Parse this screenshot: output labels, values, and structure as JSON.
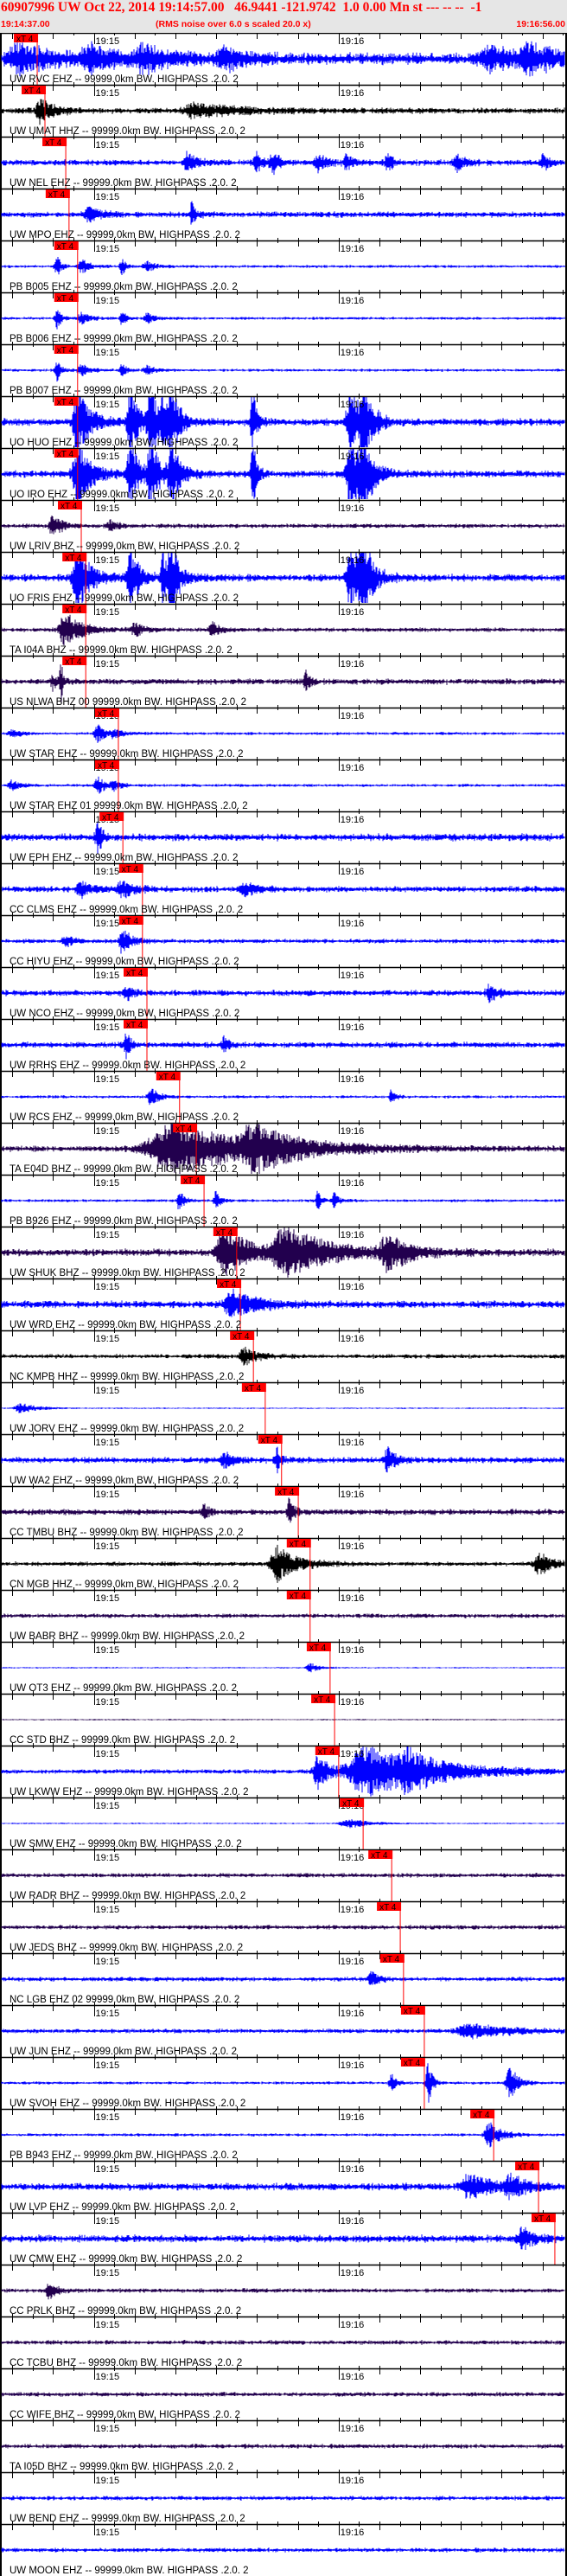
{
  "header": {
    "title_line": "60907996 UW Oct 22, 2014 19:14:57.00   46.9441 -121.9742  1.0 0.00 Mn st --- -- --  -1",
    "start_time": "19:14:37.00",
    "note": "(RMS noise over 6.0 s scaled 20.0 x)",
    "end_time": "19:16:56.00"
  },
  "colors": {
    "blue": "#0000ff",
    "purple": "#22004e",
    "black": "#000000",
    "marker": "#ff0000",
    "header_bg": "#e6e6e6"
  },
  "chart_data": {
    "type": "line",
    "title": "60907996 UW Oct 22, 2014 19:14:57.00 seismograms",
    "x_unit": "seconds after 19:14:37",
    "xlim": [
      0,
      139
    ],
    "time_ticks": [
      {
        "t": 23,
        "label": "19:15"
      },
      {
        "t": 83,
        "label": "19:16"
      }
    ],
    "marker_label": "xT 4",
    "traces": [
      {
        "label": "UW RVC EHZ -- 99999.0km BW. HIGHPASS .2.0. 2",
        "color": "blue",
        "noise": 8,
        "marker": 3.4,
        "events": [
          [
            4,
            16,
            8
          ],
          [
            22,
            14,
            6
          ],
          [
            35,
            14,
            6
          ],
          [
            55,
            12,
            5
          ],
          [
            120,
            12,
            8
          ],
          [
            130,
            14,
            6
          ]
        ]
      },
      {
        "label": "UW UMAT HHZ -- 99999.0km BW. HIGHPASS .2.0. 2",
        "color": "black",
        "noise": 4,
        "marker": 5.3,
        "events": [
          [
            10,
            14,
            3
          ],
          [
            48,
            8,
            10
          ]
        ]
      },
      {
        "label": "UW NEL EHZ -- 99999.0km BW. HIGHPASS .2.0. 2",
        "color": "blue",
        "noise": 4,
        "marker": 10.4,
        "events": [
          [
            46,
            12,
            2
          ],
          [
            63,
            10,
            2
          ],
          [
            67,
            14,
            1.5
          ],
          [
            78,
            10,
            2
          ],
          [
            85,
            10,
            1.5
          ],
          [
            95,
            14,
            1
          ],
          [
            112,
            10,
            2
          ],
          [
            133,
            10,
            1.5
          ]
        ]
      },
      {
        "label": "UW MPO EHZ -- 99999.0km BW. HIGHPASS .2.0. 2",
        "color": "blue",
        "noise": 4,
        "marker": 11.2,
        "events": [
          [
            47,
            14,
            1
          ],
          [
            22,
            8,
            3
          ]
        ]
      },
      {
        "label": "PB B005 EHZ -- 99999.0km BW. HIGHPASS .2.0. 2",
        "color": "blue",
        "noise": 2,
        "marker": 13.3,
        "events": [
          [
            14,
            12,
            1
          ],
          [
            20,
            8,
            2
          ],
          [
            30,
            10,
            1
          ],
          [
            36,
            6,
            2
          ]
        ]
      },
      {
        "label": "PB B006 EHZ -- 99999.0km BW. HIGHPASS .2.0. 2",
        "color": "blue",
        "noise": 2,
        "marker": 13.3,
        "events": [
          [
            14,
            12,
            1
          ],
          [
            20,
            8,
            2
          ],
          [
            30,
            8,
            1
          ],
          [
            36,
            6,
            2
          ]
        ]
      },
      {
        "label": "PB B007 EHZ -- 99999.0km BW. HIGHPASS .2.0. 2",
        "color": "blue",
        "noise": 2,
        "marker": 13.3,
        "events": [
          [
            14,
            12,
            1
          ],
          [
            20,
            7,
            2
          ],
          [
            30,
            8,
            1
          ],
          [
            36,
            6,
            2
          ]
        ]
      },
      {
        "label": "UO HUO EHZ -- 99999.0km BW. HIGHPASS .2.0. 2",
        "color": "blue",
        "noise": 5,
        "marker": 13.3,
        "events": [
          [
            19,
            40,
            3
          ],
          [
            32,
            40,
            2
          ],
          [
            37,
            40,
            2
          ],
          [
            40,
            25,
            1
          ],
          [
            42,
            40,
            2
          ],
          [
            62,
            40,
            1
          ],
          [
            86,
            40,
            3
          ],
          [
            89,
            40,
            2
          ]
        ]
      },
      {
        "label": "UO IRO EHZ -- 99999.0km BW. HIGHPASS .2.0. 2",
        "color": "blue",
        "noise": 5,
        "marker": 13.3,
        "events": [
          [
            19,
            40,
            3
          ],
          [
            32,
            40,
            2
          ],
          [
            37,
            40,
            2
          ],
          [
            42,
            40,
            2
          ],
          [
            62,
            40,
            1
          ],
          [
            86,
            40,
            3
          ],
          [
            89,
            40,
            2
          ]
        ]
      },
      {
        "label": "UW LRIV BHZ -- 99999.0km BW. HIGHPASS .2.0. 2",
        "color": "purple",
        "noise": 3,
        "marker": 14.2,
        "events": [
          [
            13,
            14,
            2
          ],
          [
            27,
            6,
            2
          ]
        ]
      },
      {
        "label": "UO FRIS EHZ -- 99999.0km BW. HIGHPASS .2.0. 2",
        "color": "blue",
        "noise": 5,
        "marker": 15.3,
        "events": [
          [
            19,
            40,
            3
          ],
          [
            32,
            40,
            2
          ],
          [
            40,
            30,
            1
          ],
          [
            42,
            40,
            2
          ],
          [
            86,
            40,
            3
          ],
          [
            89,
            40,
            2
          ]
        ]
      },
      {
        "label": "TA I04A BHZ -- 99999.0km BW. HIGHPASS .2.0. 2",
        "color": "purple",
        "noise": 3,
        "marker": 15.3,
        "events": [
          [
            16,
            20,
            4
          ],
          [
            33,
            8,
            2
          ],
          [
            52,
            8,
            2
          ]
        ]
      },
      {
        "label": "US NLWA BHZ 00 99999.0km BW. HIGHPASS .2.0. 2",
        "color": "purple",
        "noise": 4,
        "marker": 15.3,
        "events": [
          [
            13,
            8,
            1
          ],
          [
            15,
            25,
            0.5
          ],
          [
            75,
            12,
            1
          ]
        ]
      },
      {
        "label": "UW STAR EHZ -- 99999.0km BW. HIGHPASS .2.0. 2",
        "color": "blue",
        "noise": 2,
        "marker": 23.3,
        "events": [
          [
            3,
            6,
            2
          ],
          [
            24,
            10,
            2
          ],
          [
            28,
            5,
            2
          ]
        ]
      },
      {
        "label": "UW STAR EHZ 01 99999.0km BW. HIGHPASS .2.0. 2",
        "color": "blue",
        "noise": 2,
        "marker": 23.3,
        "events": [
          [
            3,
            6,
            2
          ],
          [
            24,
            10,
            2
          ],
          [
            28,
            5,
            2
          ]
        ]
      },
      {
        "label": "UW EPH EHZ -- 99999.0km BW. HIGHPASS .2.0. 2",
        "color": "blue",
        "noise": 5,
        "marker": 24.4,
        "events": [
          [
            24,
            20,
            1
          ]
        ]
      },
      {
        "label": "CC CLMS EHZ -- 99999.0km BW. HIGHPASS .2.0. 2",
        "color": "blue",
        "noise": 4,
        "marker": 29.2,
        "events": [
          [
            20,
            8,
            3
          ],
          [
            30,
            10,
            3
          ],
          [
            60,
            8,
            3
          ]
        ]
      },
      {
        "label": "CC HIYU EHZ -- 99999.0km BW. HIGHPASS .2.0. 2",
        "color": "blue",
        "noise": 3,
        "marker": 29.2,
        "events": [
          [
            30,
            16,
            2
          ],
          [
            16,
            6,
            2
          ]
        ]
      },
      {
        "label": "UW NCO EHZ -- 99999.0km BW. HIGHPASS .2.0. 2",
        "color": "blue",
        "noise": 4,
        "marker": 30.3,
        "events": [
          [
            31,
            8,
            2
          ],
          [
            120,
            10,
            2
          ]
        ]
      },
      {
        "label": "UW RRHS EHZ -- 99999.0km BW. HIGHPASS .2.0. 2",
        "color": "blue",
        "noise": 4,
        "marker": 30.3,
        "events": [
          [
            31,
            16,
            1
          ],
          [
            55,
            10,
            1
          ]
        ]
      },
      {
        "label": "UW RCS EHZ -- 99999.0km BW. HIGHPASS .2.0. 2",
        "color": "blue",
        "noise": 2,
        "marker": 38.3,
        "events": [
          [
            37,
            10,
            2
          ],
          [
            96,
            8,
            1
          ]
        ]
      },
      {
        "label": "TA E04D BHZ -- 99999.0km BW. HIGHPASS .2.0. 2",
        "color": "purple",
        "noise": 4,
        "marker": 42.4,
        "events": [
          [
            42,
            30,
            20
          ],
          [
            62,
            20,
            8
          ]
        ]
      },
      {
        "label": "PB B926 EHZ -- 99999.0km BW. HIGHPASS .2.0. 2",
        "color": "blue",
        "noise": 2,
        "marker": 44.3,
        "events": [
          [
            44,
            15,
            1
          ],
          [
            53,
            12,
            1
          ],
          [
            78,
            12,
            1
          ],
          [
            82,
            10,
            1
          ]
        ]
      },
      {
        "label": "UW SHUK BHZ -- 99999.0km BW. HIGHPASS .2.0. 2",
        "color": "purple",
        "noise": 5,
        "marker": 52.3,
        "events": [
          [
            55,
            30,
            6
          ],
          [
            70,
            30,
            10
          ],
          [
            95,
            20,
            5
          ]
        ]
      },
      {
        "label": "UW WRD EHZ -- 99999.0km BW. HIGHPASS .2.0. 2",
        "color": "blue",
        "noise": 5,
        "marker": 53.2,
        "events": [
          [
            57,
            15,
            6
          ]
        ]
      },
      {
        "label": "NC KMPB HHZ -- 99999.0km BW. HIGHPASS .2.0. 2",
        "color": "black",
        "noise": 3,
        "marker": 56.4,
        "events": [
          [
            60,
            10,
            3
          ]
        ]
      },
      {
        "label": "UW JORV EHZ -- 99999.0km BW. HIGHPASS .2.0. 2",
        "color": "blue",
        "noise": 1,
        "marker": 59.3,
        "events": [
          [
            5,
            6,
            4
          ]
        ]
      },
      {
        "label": "UW WA2 EHZ -- 99999.0km BW. HIGHPASS .2.0. 2",
        "color": "blue",
        "noise": 4,
        "marker": 63.3,
        "events": [
          [
            55,
            10,
            2
          ],
          [
            68,
            14,
            1
          ],
          [
            95,
            14,
            2
          ]
        ]
      },
      {
        "label": "CC TMBU BHZ -- 99999.0km BW. HIGHPASS .2.0. 2",
        "color": "purple",
        "noise": 4,
        "marker": 67.4,
        "events": [
          [
            71,
            16,
            1
          ],
          [
            50,
            10,
            1
          ]
        ]
      },
      {
        "label": "CN MGB HHZ -- 99999.0km BW. HIGHPASS .2.0. 2",
        "color": "black",
        "noise": 3,
        "marker": 70.3,
        "events": [
          [
            68,
            20,
            5
          ],
          [
            132,
            14,
            3
          ]
        ]
      },
      {
        "label": "UW BABR BHZ -- 99999.0km BW. HIGHPASS .2.0. 2",
        "color": "purple",
        "noise": 3,
        "marker": 70.3,
        "events": []
      },
      {
        "label": "UW OT3 EHZ -- 99999.0km BW. HIGHPASS .2.0. 2",
        "color": "blue",
        "noise": 1,
        "marker": 75.2,
        "events": [
          [
            76,
            6,
            2
          ]
        ]
      },
      {
        "label": "CC STD BHZ -- 99999.0km BW. HIGHPASS .2.0. 2",
        "color": "purple",
        "noise": 1,
        "marker": 76.3,
        "events": []
      },
      {
        "label": "UW LKWW EHZ -- 99999.0km BW. HIGHPASS .2.0. 2",
        "color": "blue",
        "noise": 3,
        "marker": 77.3,
        "events": [
          [
            78,
            20,
            3
          ],
          [
            90,
            30,
            15
          ],
          [
            100,
            14,
            5
          ]
        ]
      },
      {
        "label": "UW SMW EHZ -- 99999.0km BW. HIGHPASS .2.0. 2",
        "color": "blue",
        "noise": 1,
        "marker": 83.3,
        "events": [
          [
            85,
            6,
            5
          ]
        ]
      },
      {
        "label": "UW RADR BHZ -- 99999.0km BW. HIGHPASS .2.0. 2",
        "color": "purple",
        "noise": 3,
        "marker": 90.3,
        "events": []
      },
      {
        "label": "UW JEDS BHZ -- 99999.0km BW. HIGHPASS .2.0. 2",
        "color": "purple",
        "noise": 3,
        "marker": 92.4,
        "events": []
      },
      {
        "label": "NC LGB EHZ 02 99999.0km BW. HIGHPASS .2.0. 2",
        "color": "blue",
        "noise": 3,
        "marker": 93.2,
        "events": [
          [
            91,
            8,
            2
          ]
        ]
      },
      {
        "label": "UW JUN EHZ -- 99999.0km BW. HIGHPASS .2.0. 2",
        "color": "blue",
        "noise": 3,
        "marker": 98.3,
        "events": [
          [
            115,
            8,
            10
          ]
        ]
      },
      {
        "label": "UW SVOH EHZ -- 99999.0km BW. HIGHPASS .2.0. 2",
        "color": "blue",
        "noise": 2,
        "marker": 98.3,
        "events": [
          [
            96,
            12,
            1
          ],
          [
            105,
            25,
            1
          ],
          [
            125,
            20,
            2
          ]
        ]
      },
      {
        "label": "PB B943 EHZ -- 99999.0km BW. HIGHPASS .2.0. 2",
        "color": "blue",
        "noise": 2,
        "marker": 115.3,
        "events": [
          [
            120,
            14,
            3
          ]
        ]
      },
      {
        "label": "UW LVP EHZ -- 99999.0km BW. HIGHPASS .2.0. 2",
        "color": "blue",
        "noise": 5,
        "marker": 126.3,
        "events": [
          [
            115,
            15,
            5
          ],
          [
            125,
            12,
            4
          ]
        ]
      },
      {
        "label": "UW CMW EHZ -- 99999.0km BW. HIGHPASS .2.0. 2",
        "color": "blue",
        "noise": 5,
        "marker": 130.3,
        "events": [
          [
            128,
            12,
            3
          ]
        ]
      },
      {
        "label": "CC PRLK BHZ -- 99999.0km BW. HIGHPASS .2.0. 2",
        "color": "purple",
        "noise": 3,
        "marker": null,
        "events": [
          [
            12,
            10,
            2
          ]
        ]
      },
      {
        "label": "CC TCBU BHZ -- 99999.0km BW. HIGHPASS .2.0. 2",
        "color": "purple",
        "noise": 3,
        "marker": null,
        "events": []
      },
      {
        "label": "CC WIFE BHZ -- 99999.0km BW. HIGHPASS .2.0. 2",
        "color": "purple",
        "noise": 3,
        "marker": null,
        "events": []
      },
      {
        "label": "TA I05D BHZ -- 99999.0km BW. HIGHPASS .2.0. 2",
        "color": "purple",
        "noise": 3,
        "marker": null,
        "events": []
      },
      {
        "label": "UW BEND EHZ -- 99999.0km BW. HIGHPASS .2.0. 2",
        "color": "blue",
        "noise": 3,
        "marker": null,
        "events": []
      },
      {
        "label": "UW MOON EHZ -- 99999.0km BW. HIGHPASS .2.0. 2",
        "color": "blue",
        "noise": 3,
        "marker": null,
        "events": []
      }
    ]
  }
}
